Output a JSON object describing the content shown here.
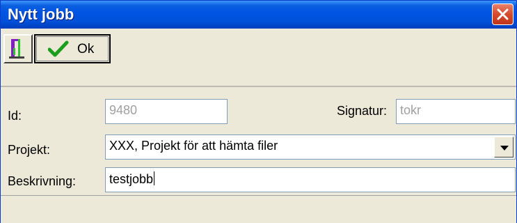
{
  "window": {
    "title": "Nytt jobb"
  },
  "toolbar": {
    "exit_icon": "exit-door-icon",
    "ok_label": "Ok",
    "ok_icon": "checkmark-icon"
  },
  "form": {
    "id_label": "Id:",
    "id_value": "9480",
    "signatur_label": "Signatur:",
    "signatur_value": "tokr",
    "projekt_label": "Projekt:",
    "projekt_value": "XXX, Projekt för att hämta filer",
    "beskrivning_label": "Beskrivning:",
    "beskrivning_value": "testjobb"
  },
  "colors": {
    "titlebar": "#0054e3",
    "close_button": "#d74a2c",
    "window_bg": "#ece9d8",
    "disabled_text": "#a0a0a0"
  }
}
